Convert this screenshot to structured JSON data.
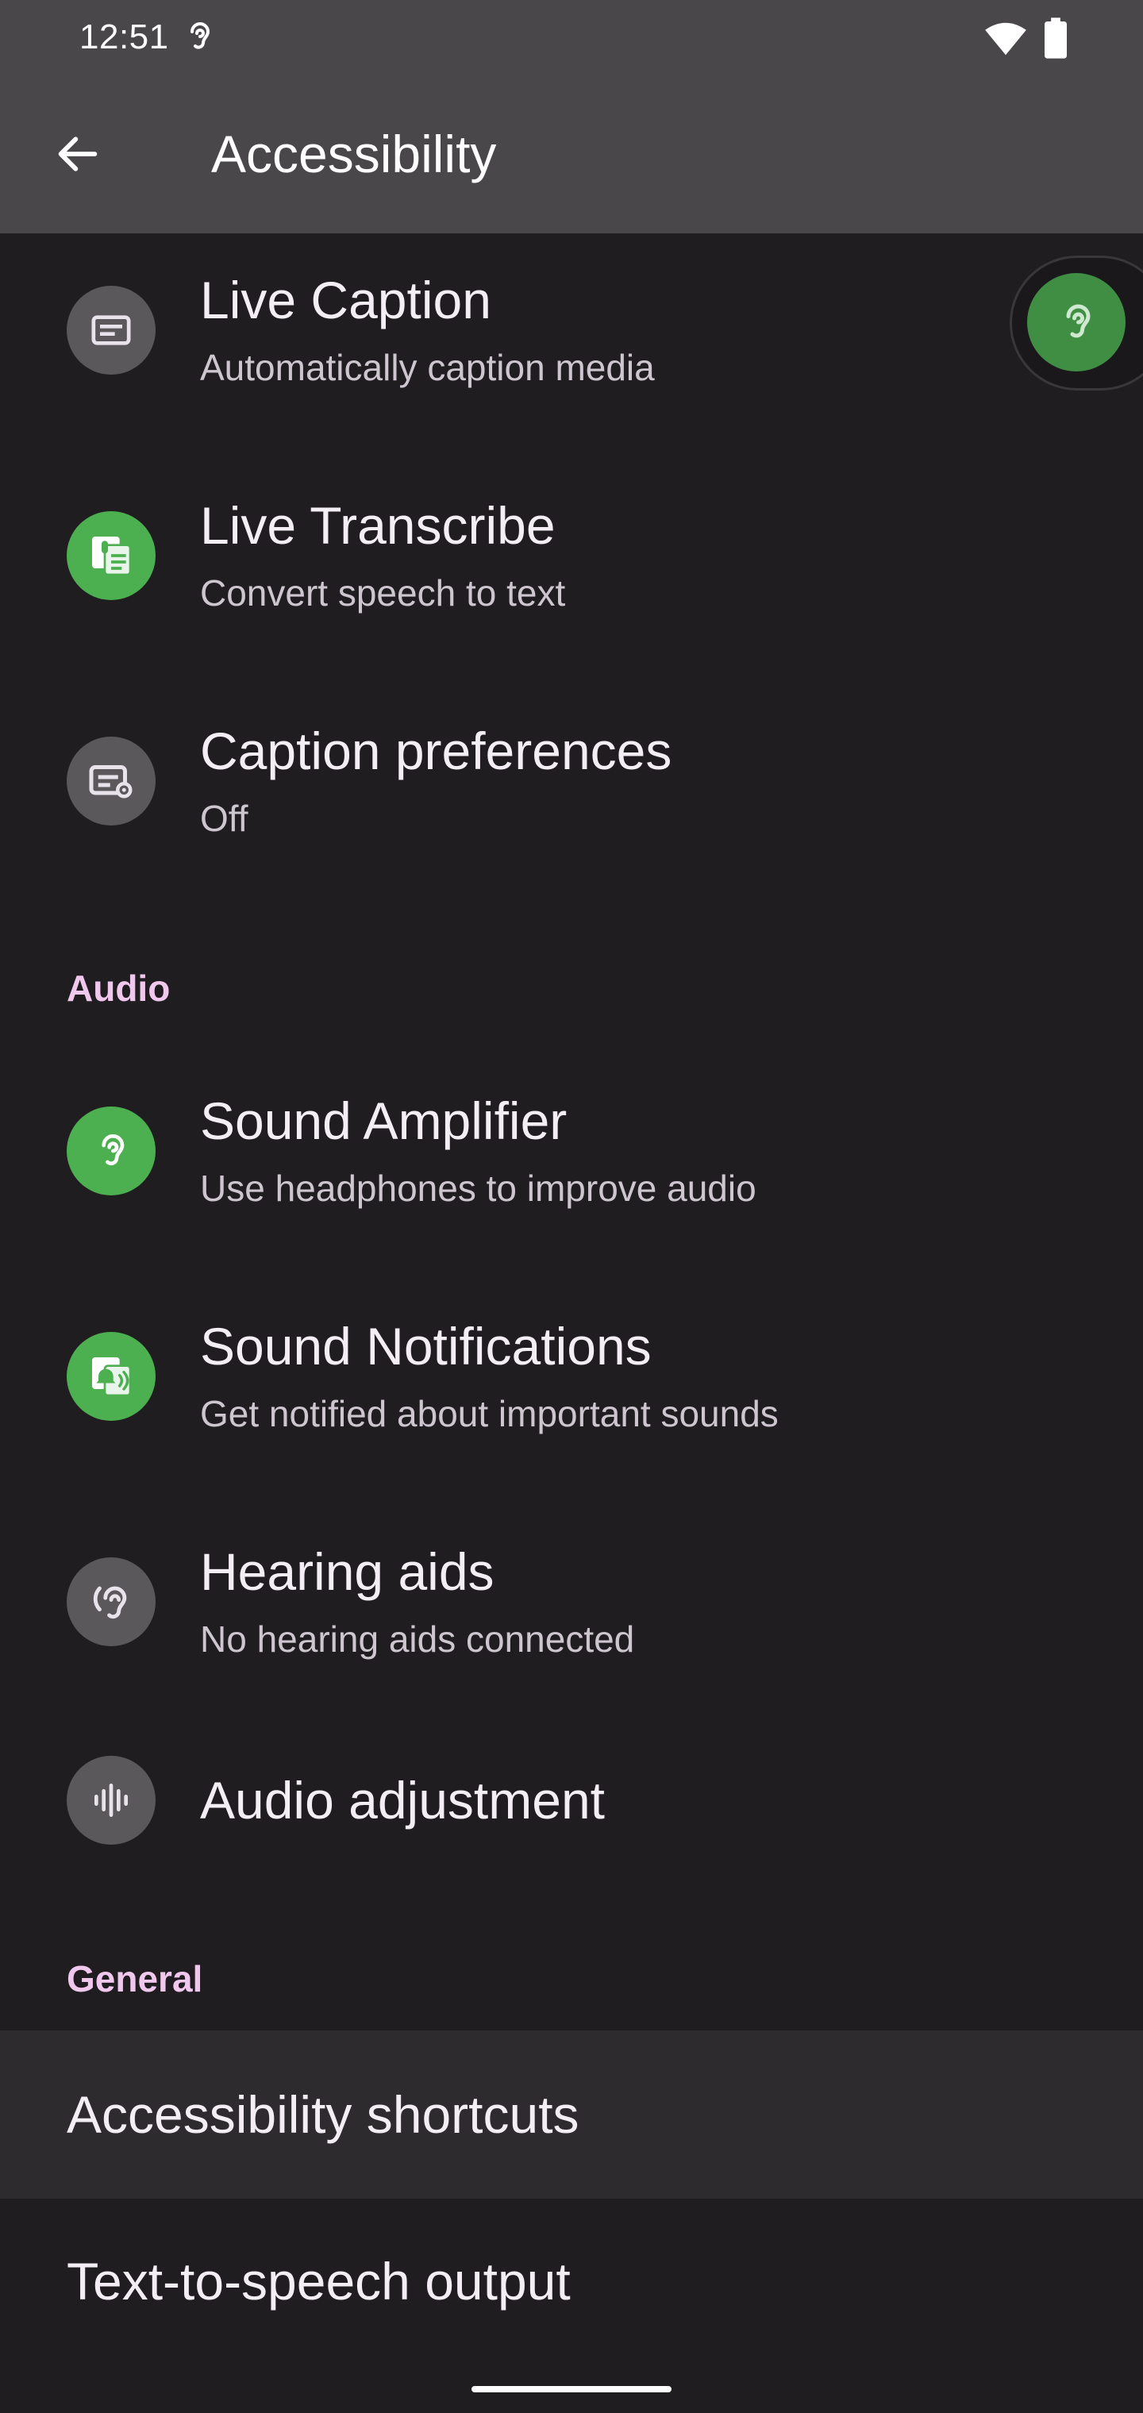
{
  "status_bar": {
    "time": "12:51",
    "icons": [
      "hearing-icon",
      "wifi-icon",
      "battery-icon"
    ]
  },
  "app_bar": {
    "back_icon": "arrow-back-icon",
    "title": "Accessibility"
  },
  "captions": [
    {
      "title": "Live Caption",
      "subtitle": "Automatically caption media",
      "icon": "live-caption-icon",
      "icon_bg": "#5b585c"
    },
    {
      "title": "Live Transcribe",
      "subtitle": "Convert speech to text",
      "icon": "live-transcribe-icon",
      "icon_bg": "#4caf50"
    },
    {
      "title": "Caption preferences",
      "subtitle": "Off",
      "icon": "caption-preferences-icon",
      "icon_bg": "#5b585c"
    }
  ],
  "audio": {
    "header": "Audio",
    "items": [
      {
        "title": "Sound Amplifier",
        "subtitle": "Use headphones to improve audio",
        "icon": "sound-amplifier-icon",
        "icon_bg": "#4caf50"
      },
      {
        "title": "Sound Notifications",
        "subtitle": "Get notified about important sounds",
        "icon": "sound-notifications-icon",
        "icon_bg": "#4caf50"
      },
      {
        "title": "Hearing aids",
        "subtitle": "No hearing aids connected",
        "icon": "hearing-aids-icon",
        "icon_bg": "#5b585c"
      },
      {
        "title": "Audio adjustment",
        "icon": "audio-adjustment-icon",
        "icon_bg": "#5b585c"
      }
    ]
  },
  "general": {
    "header": "General",
    "items": [
      {
        "title": "Accessibility shortcuts"
      },
      {
        "title": "Text-to-speech output"
      }
    ]
  },
  "floating_button": {
    "icon": "hearing-icon",
    "color": "#3f8e44"
  },
  "colors": {
    "background": "#201d21",
    "app_bar": "#4a474b",
    "section_header": "#f0c8ee",
    "green_accent": "#4caf50"
  }
}
